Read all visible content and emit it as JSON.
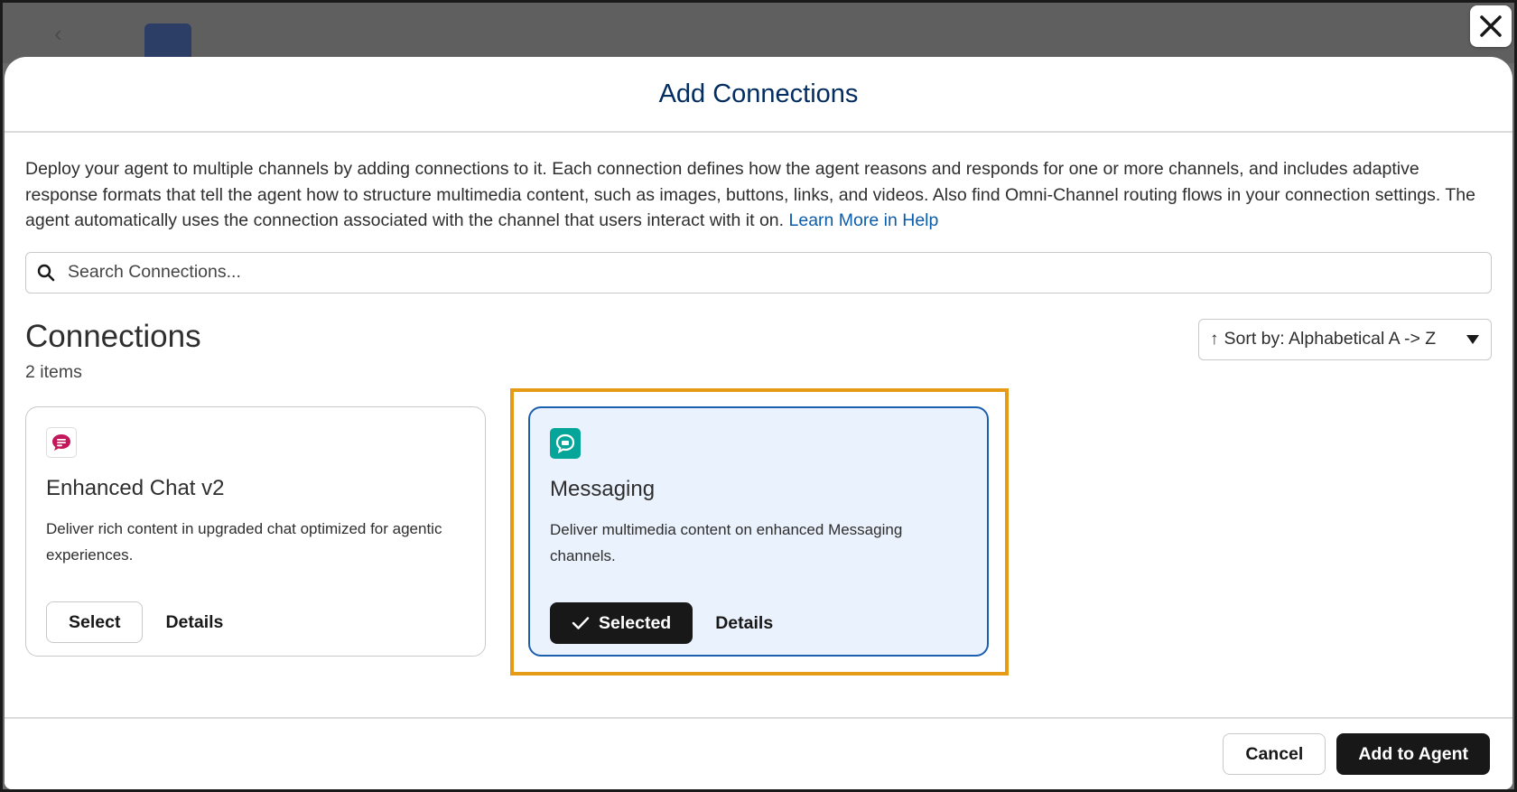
{
  "modal": {
    "title": "Add Connections",
    "description": "Deploy your agent to multiple channels by adding connections to it. Each connection defines how the agent reasons and responds for one or more channels, and includes adaptive response formats that tell the agent how to structure multimedia content, such as images, buttons, links, and videos. Also find Omni-Channel routing flows in your connection settings. The agent automatically uses the connection associated with the channel that users interact with it on.",
    "help_link": "Learn More in Help"
  },
  "search": {
    "placeholder": "Search Connections..."
  },
  "section": {
    "title": "Connections",
    "count": "2 items",
    "sort_label": "Sort by: Alphabetical A -> Z"
  },
  "cards": [
    {
      "title": "Enhanced Chat v2",
      "description": "Deliver rich content in upgraded chat optimized for agentic experiences.",
      "primary_label": "Select",
      "details_label": "Details",
      "icon": "chat-bubble-icon",
      "state": "unselected"
    },
    {
      "title": "Messaging",
      "description": "Deliver multimedia content on enhanced Messaging channels.",
      "primary_label": "Selected",
      "details_label": "Details",
      "icon": "messaging-icon",
      "state": "selected"
    }
  ],
  "footer": {
    "cancel_label": "Cancel",
    "add_label": "Add to Agent"
  },
  "colors": {
    "accent_title": "#032d60",
    "link": "#0b5cab",
    "highlight": "#e69b16",
    "selected_card_bg": "#eaf2fd",
    "selected_card_border": "#1b5faf",
    "messaging_icon_bg": "#06a59a",
    "chat_icon": "#c2185b"
  }
}
